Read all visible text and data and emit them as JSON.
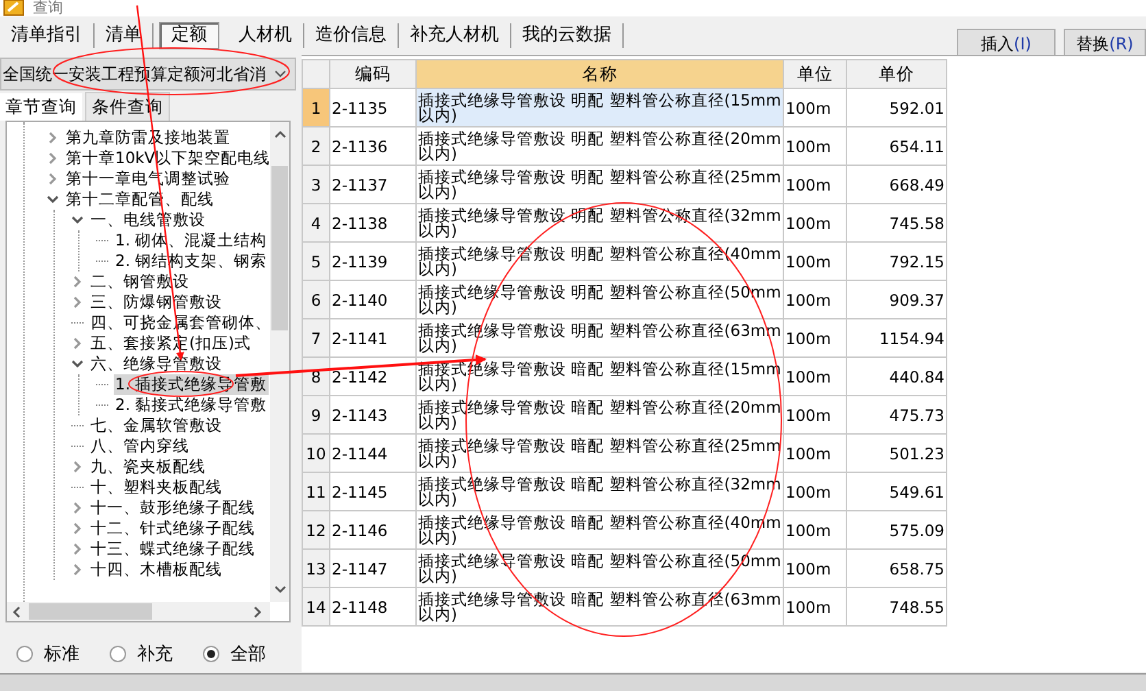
{
  "window": {
    "title": "查询"
  },
  "tabs": [
    {
      "label": "清单指引",
      "selected": false
    },
    {
      "label": "清单",
      "selected": false
    },
    {
      "label": "定额",
      "selected": true
    },
    {
      "label": "人材机",
      "selected": false
    },
    {
      "label": "造价信息",
      "selected": false
    },
    {
      "label": "补充人材机",
      "selected": false
    },
    {
      "label": "我的云数据",
      "selected": false
    }
  ],
  "buttons": [
    {
      "label": "插入",
      "hotkey": "(I)"
    },
    {
      "label": "替换",
      "hotkey": "(R)"
    }
  ],
  "library_select": {
    "value": "全国统一安装工程预算定额河北省消"
  },
  "search_tabs": [
    {
      "label": "章节查询",
      "selected": true
    },
    {
      "label": "条件查询",
      "selected": false
    }
  ],
  "tree": [
    {
      "label": "第九章防雷及接地装置",
      "kind": "folder",
      "expanded": false
    },
    {
      "label": "第十章10kV以下架空配电线",
      "kind": "folder",
      "expanded": false
    },
    {
      "label": "第十一章电气调整试验",
      "kind": "folder",
      "expanded": false
    },
    {
      "label": "第十二章配管、配线",
      "kind": "folder",
      "expanded": true,
      "children": [
        {
          "label": "一、电线管敷设",
          "kind": "folder",
          "expanded": true,
          "children": [
            {
              "label": "1. 砌体、混凝土结构",
              "kind": "leaf",
              "selected": false
            },
            {
              "label": "2. 钢结构支架、钢索",
              "kind": "leaf",
              "selected": false
            }
          ]
        },
        {
          "label": "二、钢管敷设",
          "kind": "folder",
          "expanded": false
        },
        {
          "label": "三、防爆钢管敷设",
          "kind": "folder",
          "expanded": false
        },
        {
          "label": "四、可挠金属套管砌体、",
          "kind": "leaf",
          "selected": false
        },
        {
          "label": "五、套接紧定(扣压)式",
          "kind": "folder",
          "expanded": false
        },
        {
          "label": "六、绝缘导管敷设",
          "kind": "folder",
          "expanded": true,
          "children": [
            {
              "label": "1. 插接式绝缘导管敷",
              "kind": "leaf",
              "selected": true
            },
            {
              "label": "2. 黏接式绝缘导管敷",
              "kind": "leaf",
              "selected": false
            }
          ]
        },
        {
          "label": "七、金属软管敷设",
          "kind": "leaf",
          "selected": false
        },
        {
          "label": "八、管内穿线",
          "kind": "leaf",
          "selected": false
        },
        {
          "label": "九、瓷夹板配线",
          "kind": "folder",
          "expanded": false
        },
        {
          "label": "十、塑料夹板配线",
          "kind": "leaf",
          "selected": false
        },
        {
          "label": "十一、鼓形绝缘子配线",
          "kind": "folder",
          "expanded": false
        },
        {
          "label": "十二、针式绝缘子配线",
          "kind": "folder",
          "expanded": false
        },
        {
          "label": "十三、蝶式绝缘子配线",
          "kind": "folder",
          "expanded": false
        },
        {
          "label": "十四、木槽板配线",
          "kind": "folder",
          "expanded": false
        }
      ]
    }
  ],
  "filter": [
    {
      "label": "标准",
      "selected": false
    },
    {
      "label": "补充",
      "selected": false
    },
    {
      "label": "全部",
      "selected": true
    }
  ],
  "table": {
    "columns": [
      "编码",
      "名称",
      "单位",
      "单价"
    ],
    "rows": [
      {
        "no": "1",
        "code": "2-1135",
        "name": "插接式绝缘导管敷设 明配 塑料管公称直径(15mm以内)",
        "unit": "100m",
        "price": "592.01",
        "selected": true
      },
      {
        "no": "2",
        "code": "2-1136",
        "name": "插接式绝缘导管敷设 明配 塑料管公称直径(20mm以内)",
        "unit": "100m",
        "price": "654.11",
        "selected": false
      },
      {
        "no": "3",
        "code": "2-1137",
        "name": "插接式绝缘导管敷设 明配 塑料管公称直径(25mm以内)",
        "unit": "100m",
        "price": "668.49",
        "selected": false
      },
      {
        "no": "4",
        "code": "2-1138",
        "name": "插接式绝缘导管敷设 明配 塑料管公称直径(32mm以内)",
        "unit": "100m",
        "price": "745.58",
        "selected": false
      },
      {
        "no": "5",
        "code": "2-1139",
        "name": "插接式绝缘导管敷设 明配 塑料管公称直径(40mm以内)",
        "unit": "100m",
        "price": "792.15",
        "selected": false
      },
      {
        "no": "6",
        "code": "2-1140",
        "name": "插接式绝缘导管敷设 明配 塑料管公称直径(50mm以内)",
        "unit": "100m",
        "price": "909.37",
        "selected": false
      },
      {
        "no": "7",
        "code": "2-1141",
        "name": "插接式绝缘导管敷设 明配 塑料管公称直径(63mm以内)",
        "unit": "100m",
        "price": "1154.94",
        "selected": false
      },
      {
        "no": "8",
        "code": "2-1142",
        "name": "插接式绝缘导管敷设 暗配 塑料管公称直径(15mm以内)",
        "unit": "100m",
        "price": "440.84",
        "selected": false
      },
      {
        "no": "9",
        "code": "2-1143",
        "name": "插接式绝缘导管敷设 暗配 塑料管公称直径(20mm以内)",
        "unit": "100m",
        "price": "475.73",
        "selected": false
      },
      {
        "no": "10",
        "code": "2-1144",
        "name": "插接式绝缘导管敷设 暗配 塑料管公称直径(25mm以内)",
        "unit": "100m",
        "price": "501.23",
        "selected": false
      },
      {
        "no": "11",
        "code": "2-1145",
        "name": "插接式绝缘导管敷设 暗配 塑料管公称直径(32mm以内)",
        "unit": "100m",
        "price": "549.61",
        "selected": false
      },
      {
        "no": "12",
        "code": "2-1146",
        "name": "插接式绝缘导管敷设 暗配 塑料管公称直径(40mm以内)",
        "unit": "100m",
        "price": "575.09",
        "selected": false
      },
      {
        "no": "13",
        "code": "2-1147",
        "name": "插接式绝缘导管敷设 暗配 塑料管公称直径(50mm以内)",
        "unit": "100m",
        "price": "658.75",
        "selected": false
      },
      {
        "no": "14",
        "code": "2-1148",
        "name": "插接式绝缘导管敷设 暗配 塑料管公称直径(63mm以内)",
        "unit": "100m",
        "price": "748.55",
        "selected": false
      }
    ]
  }
}
